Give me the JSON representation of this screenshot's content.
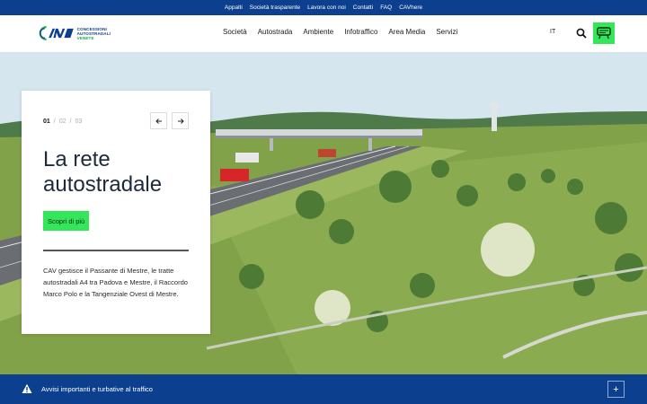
{
  "topbar": {
    "links": [
      "Appalti",
      "Società trasparente",
      "Lavora con noi",
      "Contatti",
      "FAQ",
      "CAVhere"
    ]
  },
  "header": {
    "logo": {
      "line1": "CONCESSIONI",
      "line2": "AUTOSTRADALI",
      "line3": "VENETE"
    },
    "nav": [
      "Società",
      "Autostrada",
      "Ambiente",
      "Infotraffico",
      "Area Media",
      "Servizi"
    ],
    "language": "IT",
    "icons": {
      "search": "search-icon",
      "cta": "traffic-icon"
    },
    "accent_color": "#33e65a",
    "brand_color": "#0d3f8f"
  },
  "hero": {
    "slides": {
      "current": "01",
      "second": "02",
      "third": "03",
      "separator": "/"
    },
    "title": "La rete autostradale",
    "cta_label": "Scopri di più",
    "description": "CAV gestisce il Passante di Mestre, le tratte autostradali A4 tra Padova e Mestre, il Raccordo Marco Polo e la Tangenziale Ovest di Mestre.",
    "prev_icon": "arrow-left-icon",
    "next_icon": "arrow-right-icon"
  },
  "alert": {
    "text": "Avvisi importanti e turbative al traffico",
    "icon": "warning-icon",
    "expand_label": "+"
  }
}
